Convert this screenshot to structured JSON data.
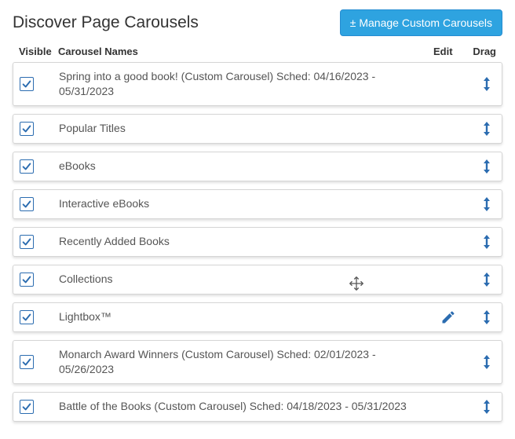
{
  "header": {
    "title": "Discover Page Carousels",
    "manage_btn": "± Manage Custom Carousels"
  },
  "columns": {
    "visible": "Visible",
    "names": "Carousel Names",
    "edit": "Edit",
    "drag": "Drag"
  },
  "rows": [
    {
      "visible": true,
      "name": "Spring into a good book! (Custom Carousel) Sched: 04/16/2023 - 05/31/2023",
      "editable": false,
      "show_move_cursor": false
    },
    {
      "visible": true,
      "name": "Popular Titles",
      "editable": false,
      "show_move_cursor": false
    },
    {
      "visible": true,
      "name": "eBooks",
      "editable": false,
      "show_move_cursor": false
    },
    {
      "visible": true,
      "name": "Interactive eBooks",
      "editable": false,
      "show_move_cursor": false
    },
    {
      "visible": true,
      "name": "Recently Added Books",
      "editable": false,
      "show_move_cursor": false
    },
    {
      "visible": true,
      "name": "Collections",
      "editable": false,
      "show_move_cursor": true
    },
    {
      "visible": true,
      "name": "Lightbox™",
      "editable": true,
      "show_move_cursor": false
    },
    {
      "visible": true,
      "name": "Monarch Award Winners (Custom Carousel) Sched: 02/01/2023 - 05/26/2023",
      "editable": false,
      "show_move_cursor": false
    },
    {
      "visible": true,
      "name": "Battle of the Books (Custom Carousel) Sched: 04/18/2023 - 05/31/2023",
      "editable": false,
      "show_move_cursor": false
    }
  ],
  "colors": {
    "accent": "#2b6cb0",
    "btn_bg": "#2ea3e0"
  }
}
